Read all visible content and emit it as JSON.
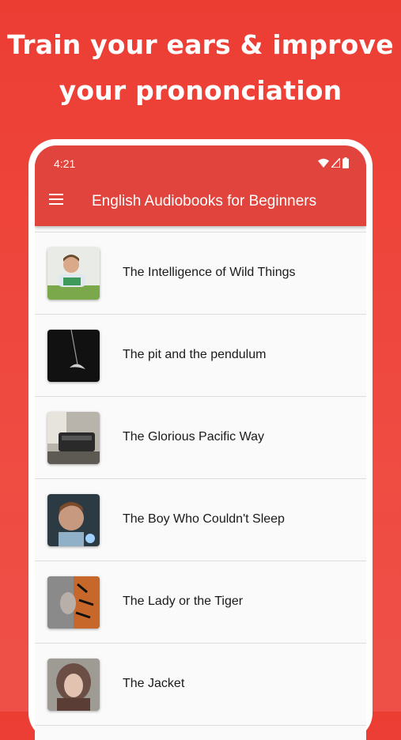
{
  "headline": {
    "line1": "Train your ears & improve",
    "line2": "your prononciation"
  },
  "status_bar": {
    "time": "4:21",
    "icons": [
      "wifi-icon",
      "signal-icon",
      "battery-icon"
    ]
  },
  "app_bar": {
    "menu_icon": "menu-icon",
    "title": "English Audiobooks for Beginners"
  },
  "colors": {
    "background": "#ec3d33",
    "app_bar": "#e0443c",
    "text": "#1a1a1a"
  },
  "books": [
    {
      "title": "The Intelligence of Wild Things"
    },
    {
      "title": "The pit and the pendulum"
    },
    {
      "title": "The Glorious Pacific Way"
    },
    {
      "title": "The Boy Who Couldn't Sleep"
    },
    {
      "title": "The Lady or the Tiger"
    },
    {
      "title": "The Jacket"
    }
  ]
}
